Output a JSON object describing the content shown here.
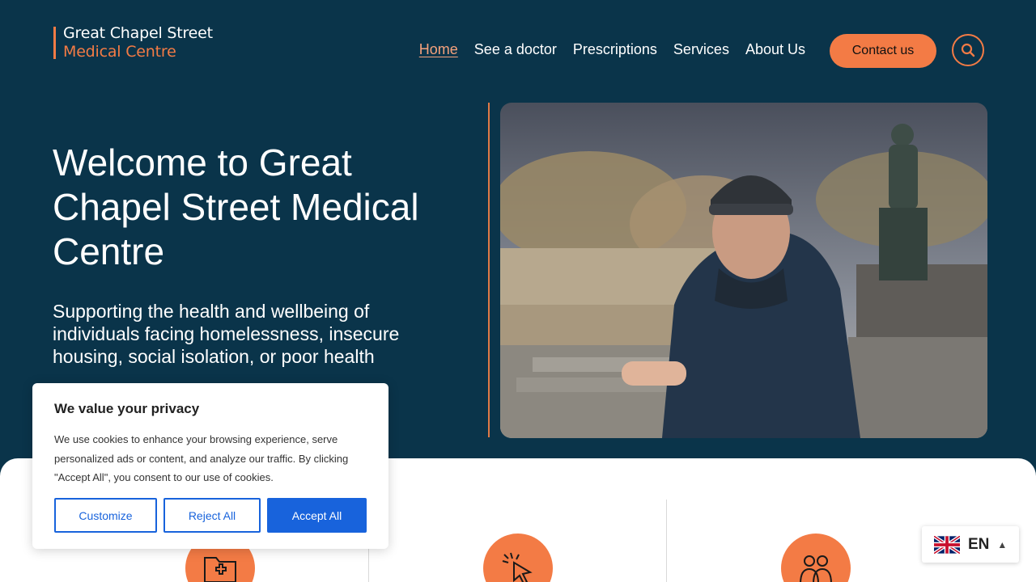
{
  "logo": {
    "line1": "Great Chapel Street",
    "line2": "Medical Centre"
  },
  "nav": {
    "items": [
      {
        "label": "Home",
        "active": true
      },
      {
        "label": "See a doctor"
      },
      {
        "label": "Prescriptions"
      },
      {
        "label": "Services"
      },
      {
        "label": "About Us"
      }
    ],
    "contact_label": "Contact us",
    "search_icon": "search-icon"
  },
  "hero": {
    "title": "Welcome to Great Chapel Street Medical Centre",
    "subtitle": "Supporting the health and wellbeing of individuals facing homelessness, insecure housing, social isolation, or poor health"
  },
  "features": {
    "icons": [
      "medical-folder-icon",
      "click-cursor-icon",
      "people-icon"
    ]
  },
  "cookie": {
    "title": "We value your privacy",
    "text": "We use cookies to enhance your browsing experience, serve personalized ads or content, and analyze our traffic. By clicking \"Accept All\", you consent to our use of cookies.",
    "customize": "Customize",
    "reject": "Reject All",
    "accept": "Accept All"
  },
  "language": {
    "code": "EN",
    "flag": "uk-flag-icon"
  },
  "colors": {
    "navy": "#0a344a",
    "accent": "#f37b45",
    "cookie_blue": "#1863dc"
  }
}
